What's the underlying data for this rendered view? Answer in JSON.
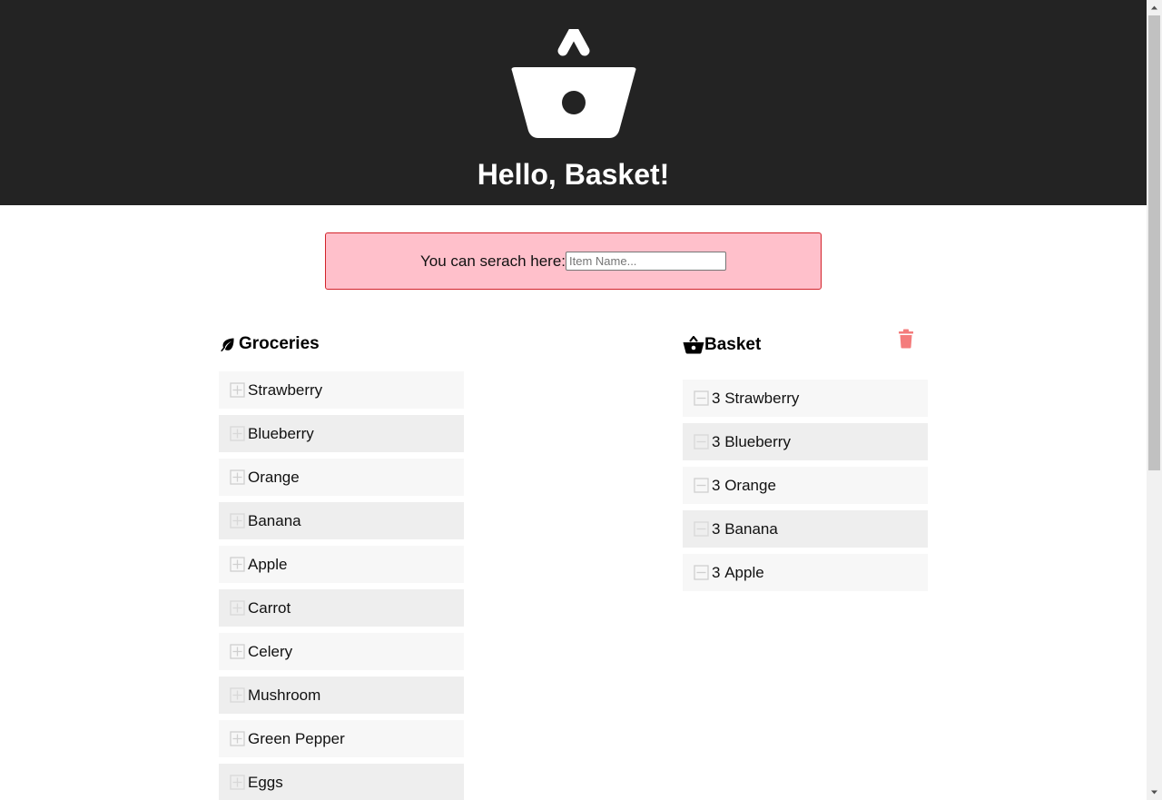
{
  "header": {
    "title": "Hello, Basket!",
    "logo_icon": "basket-icon"
  },
  "search": {
    "label": "You can serach here:",
    "placeholder": "Item Name...",
    "value": ""
  },
  "groceries": {
    "title": "Groceries",
    "title_icon": "leaf-icon",
    "item_icon": "plus-square-icon",
    "items": [
      "Strawberry",
      "Blueberry",
      "Orange",
      "Banana",
      "Apple",
      "Carrot",
      "Celery",
      "Mushroom",
      "Green Pepper",
      "Eggs"
    ]
  },
  "basket": {
    "title": "Basket",
    "title_icon": "basket-icon",
    "clear_icon": "trash-icon",
    "item_icon": "minus-square-icon",
    "items": [
      {
        "qty": "3",
        "name": "Strawberry"
      },
      {
        "qty": "3",
        "name": "Blueberry"
      },
      {
        "qty": "3",
        "name": "Orange"
      },
      {
        "qty": "3",
        "name": "Banana"
      },
      {
        "qty": "3",
        "name": "Apple"
      }
    ]
  },
  "colors": {
    "header_bg": "#232323",
    "search_bg": "#ffc0cb",
    "search_border": "#d2232a",
    "trash": "#f47c7c",
    "row_light": "#f7f7f7",
    "row_dark": "#eeeeee"
  }
}
